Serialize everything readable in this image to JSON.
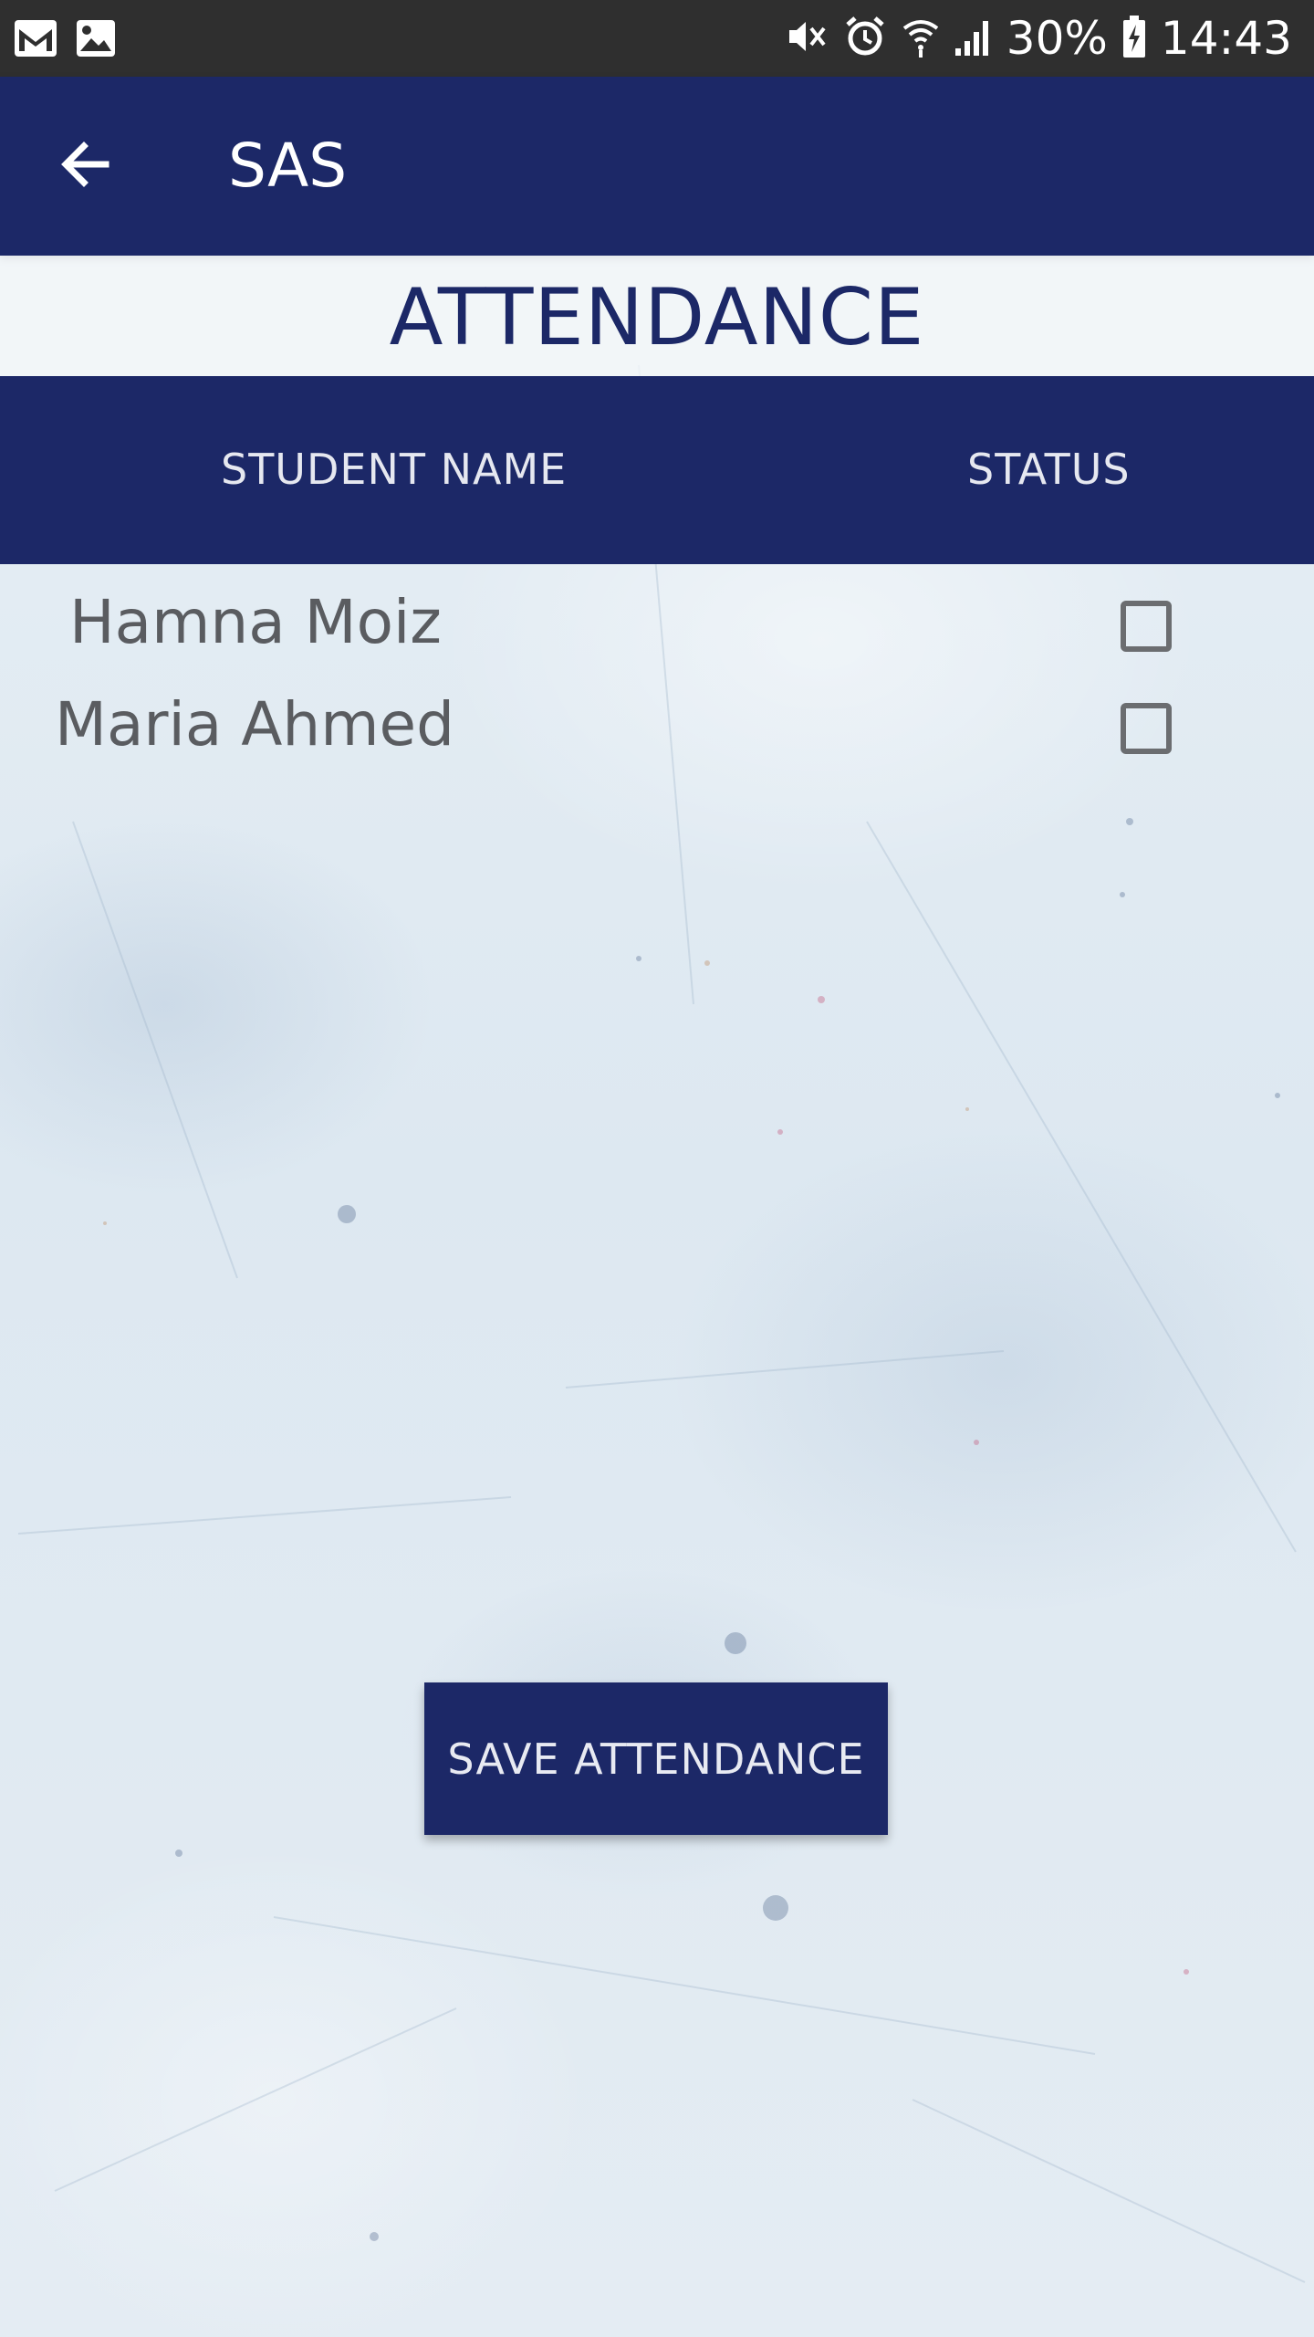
{
  "status_bar": {
    "battery": "30%",
    "time": "14:43",
    "left_icons": [
      "gmail-icon",
      "image-icon"
    ],
    "right_icons": [
      "mute-icon",
      "alarm-icon",
      "wifi-icon",
      "signal-icon",
      "battery-charging-icon"
    ]
  },
  "app_bar": {
    "title": "SAS",
    "back_icon": "arrow-back-icon"
  },
  "page": {
    "heading": "ATTENDANCE"
  },
  "table": {
    "columns": [
      "STUDENT NAME",
      "STATUS"
    ],
    "rows": [
      {
        "name": "Hamna Moiz",
        "checked": false
      },
      {
        "name": "Maria Ahmed",
        "checked": false
      }
    ]
  },
  "actions": {
    "save_label": "SAVE ATTENDANCE"
  },
  "colors": {
    "primary": "#1c2867",
    "status_bar": "#2f2f2f",
    "row_text": "#5a5c60"
  }
}
